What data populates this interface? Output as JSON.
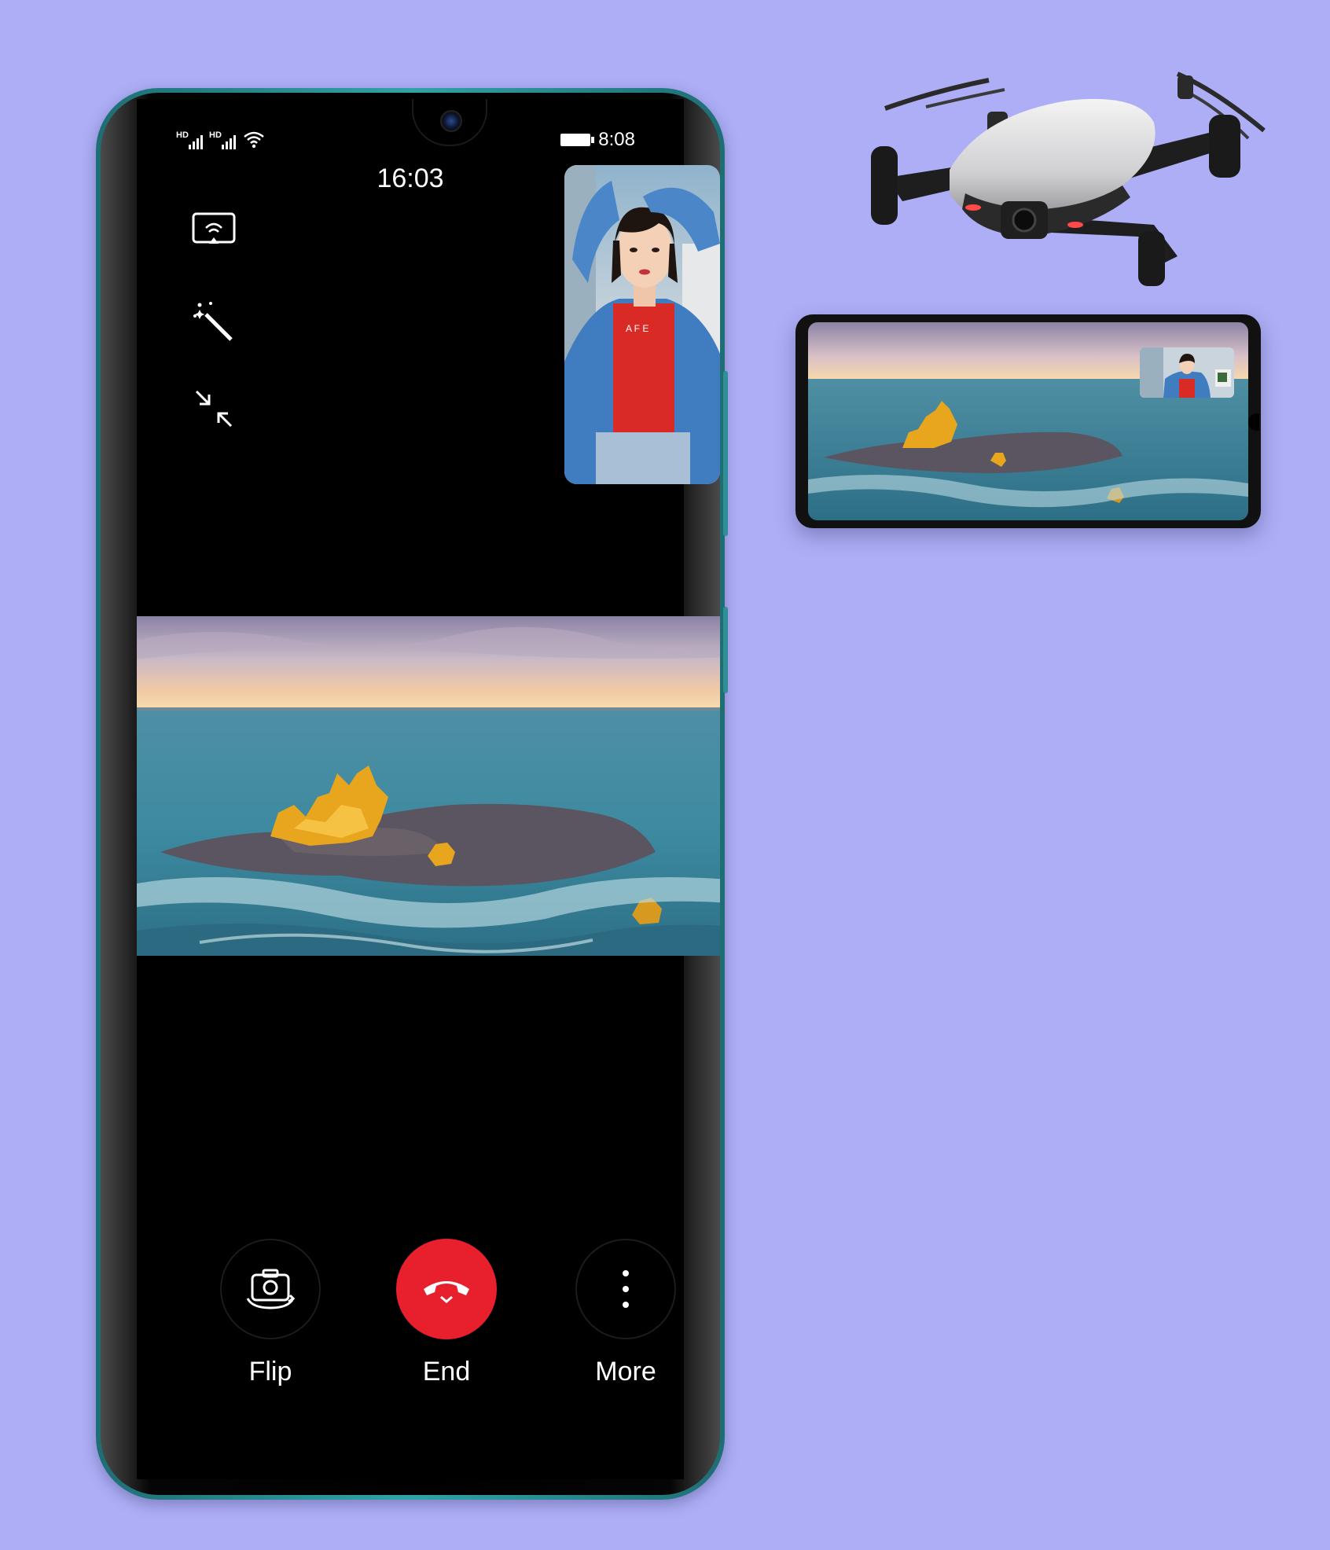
{
  "status_bar": {
    "sim1": "HD",
    "sim2": "HD",
    "time": "8:08"
  },
  "call": {
    "duration": "16:03"
  },
  "controls": {
    "cast_icon": "screen-cast-icon",
    "beauty_icon": "magic-wand-icon",
    "minimize_icon": "minimize-arrows-icon"
  },
  "actions": [
    {
      "label": "Flip",
      "icon": "flip-camera-icon"
    },
    {
      "label": "End",
      "icon": "end-call-icon"
    },
    {
      "label": "More",
      "icon": "more-vertical-icon"
    }
  ],
  "colors": {
    "background": "#aeaef7",
    "end_call": "#e8202e",
    "phone_frame": "#2fa3a9"
  }
}
